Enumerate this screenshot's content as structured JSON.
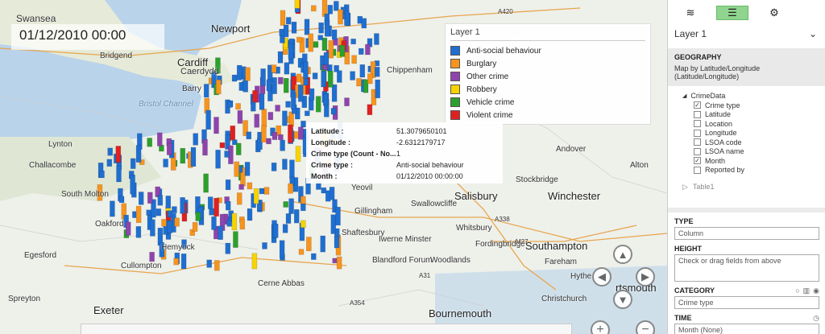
{
  "app": {
    "datetime": "01/12/2010 00:00"
  },
  "places": {
    "swansea": "Swansea",
    "newport": "Newport",
    "cardiff": "Cardiff",
    "caerdydd": "Caerdydd",
    "bridgend": "Bridgend",
    "barry": "Barry",
    "bristol_channel": "Bristol Channel",
    "chippenham": "Chippenham",
    "lynton": "Lynton",
    "challacombe": "Challacombe",
    "southmolton": "South Molton",
    "oakford": "Oakford",
    "hemyock": "Hemyock",
    "cullompton": "Cullompton",
    "exeter": "Exeter",
    "egesford": "Egesford",
    "spreyton": "Spreyton",
    "yeovil": "Yeovil",
    "gillingham": "Gillingham",
    "shaftesbury": "Shaftesbury",
    "blandford": "Blandford Forum",
    "iwerne": "Iwerne Minster",
    "woodlands": "Woodlands",
    "crimeabbas": "Cerne Abbas",
    "salisbury": "Salisbury",
    "swallowcliffe": "Swallowcliffe",
    "whitsbury": "Whitsbury",
    "fordingbridge": "Fordingbridge",
    "winchester": "Winchester",
    "southampton": "Southampton",
    "fareham": "Fareham",
    "bournemouth": "Bournemouth",
    "crimechurch": "Christchurch",
    "stockbridge": "Stockbridge",
    "andover": "Andover",
    "alton": "Alton",
    "portsmouth": "rtsmouth",
    "hythe": "Hythe",
    "a420": "A420",
    "m27": "M27",
    "a338": "A338",
    "a354": "A354",
    "a31": "A31"
  },
  "legend": {
    "title": "Layer 1",
    "items": [
      {
        "label": "Anti-social behaviour",
        "color": "#1f6fd1"
      },
      {
        "label": "Burglary",
        "color": "#f7941d"
      },
      {
        "label": "Other crime",
        "color": "#8e44ad"
      },
      {
        "label": "Robbery",
        "color": "#f7d300"
      },
      {
        "label": "Vehicle crime",
        "color": "#2ca02c"
      },
      {
        "label": "Violent crime",
        "color": "#e02020"
      }
    ]
  },
  "tooltip": {
    "rows": [
      {
        "k": "Latitude :",
        "v": "51.3079650101"
      },
      {
        "k": "Longitude :",
        "v": "-2.6312179717"
      },
      {
        "k": "Crime type (Count - No...",
        "v": "1"
      },
      {
        "k": "Crime type :",
        "v": "Anti-social behaviour"
      },
      {
        "k": "Month :",
        "v": "01/12/2010 00:00:00"
      }
    ]
  },
  "panel": {
    "layer_name": "Layer 1",
    "geography_header": "GEOGRAPHY",
    "geography_sub": "Map by Latitude/Longitude (Latitude/Longitude)",
    "tree_root": "CrimeData",
    "fields": [
      {
        "label": "Crime type",
        "checked": true
      },
      {
        "label": "Latitude",
        "checked": false
      },
      {
        "label": "Location",
        "checked": false
      },
      {
        "label": "Longitude",
        "checked": false
      },
      {
        "label": "LSOA code",
        "checked": false
      },
      {
        "label": "LSOA name",
        "checked": false
      },
      {
        "label": "Month",
        "checked": true
      },
      {
        "label": "Reported by",
        "checked": false
      }
    ],
    "table2": "Table1",
    "type_header": "TYPE",
    "type_value": "Column",
    "height_header": "HEIGHT",
    "height_placeholder": "Check or drag fields from above",
    "category_header": "CATEGORY",
    "category_value": "Crime type",
    "time_header": "TIME",
    "time_value": "Month (None)"
  },
  "icons": {
    "check": "✓",
    "tri_open": "◢",
    "tri_closed": "▷",
    "dropdown": "⌄"
  }
}
